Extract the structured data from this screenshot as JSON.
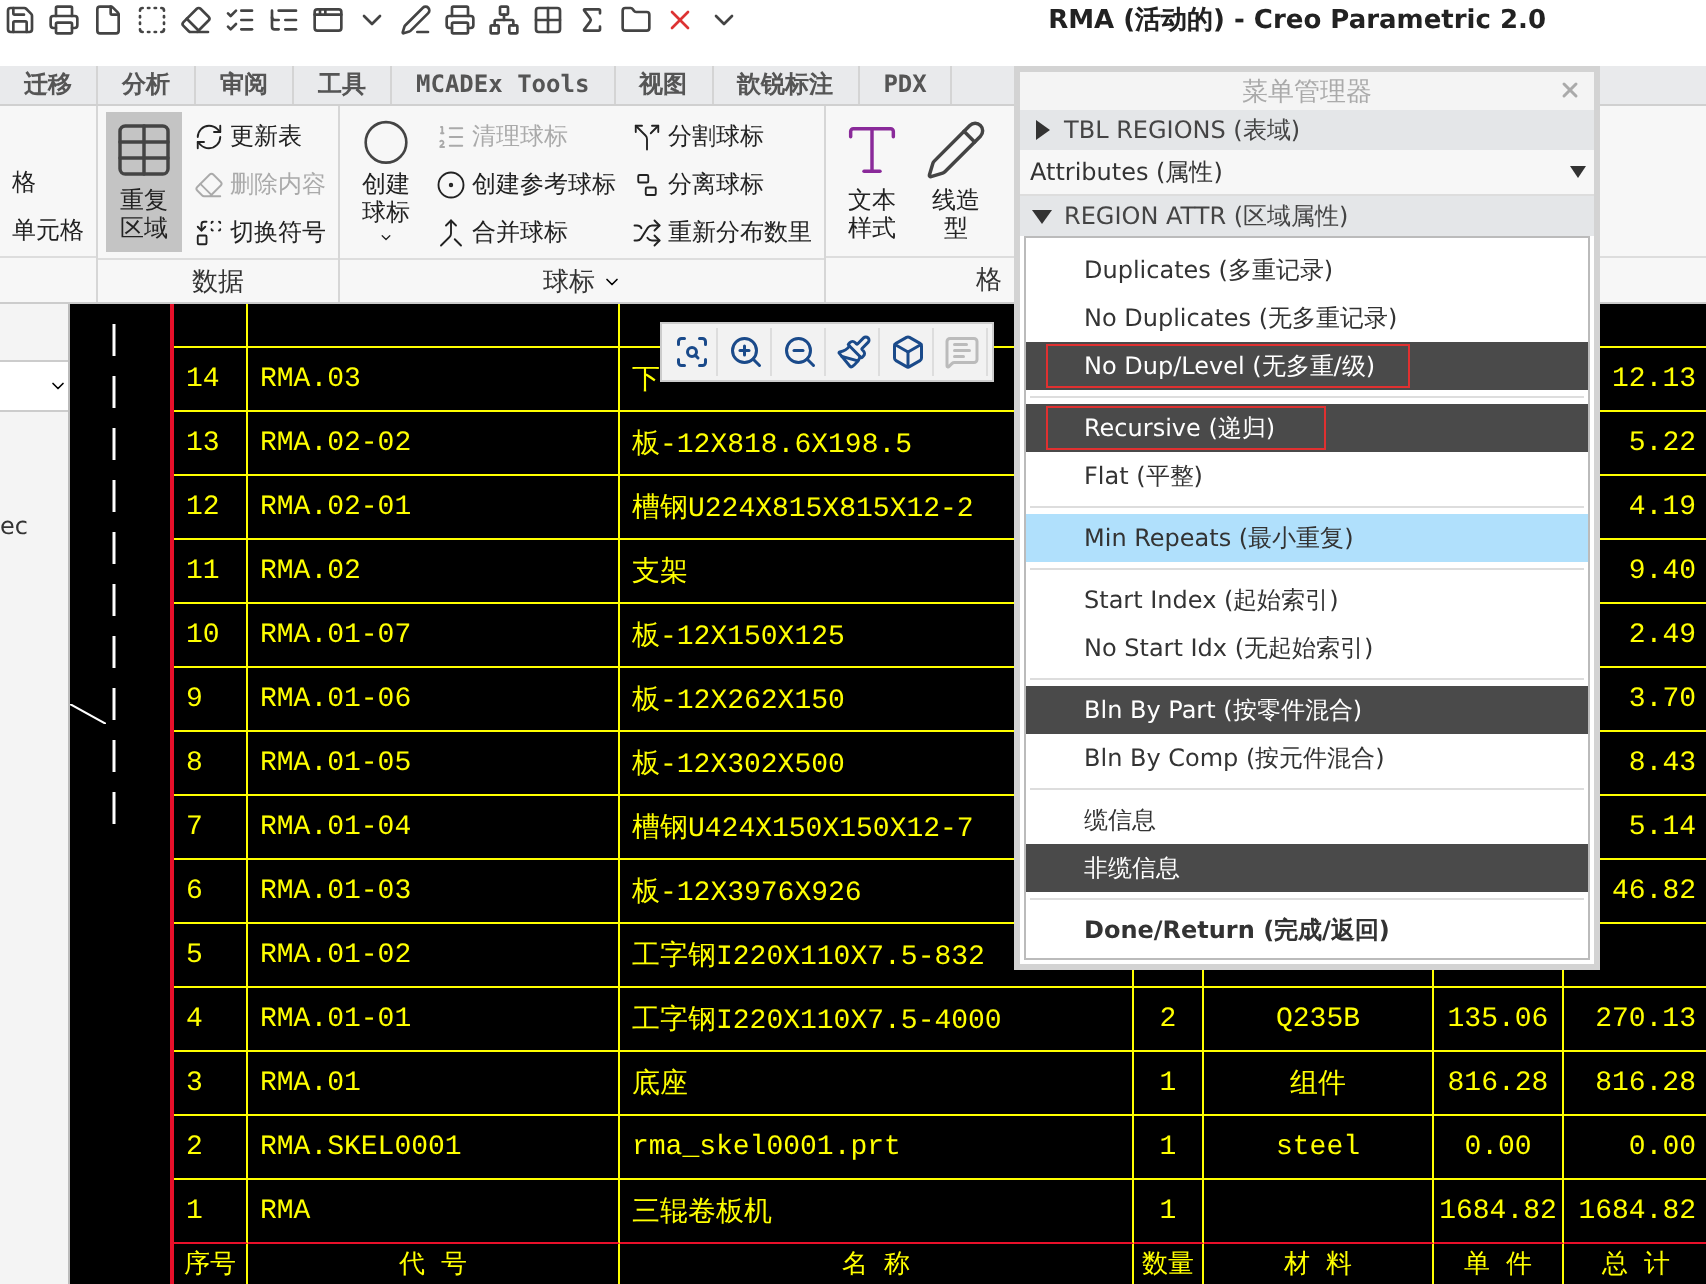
{
  "title_bar": {
    "title": "RMA (活动的) - Creo Parametric 2.0"
  },
  "ribbon_tabs": [
    {
      "label": "迁移",
      "selected": false
    },
    {
      "label": "分析",
      "selected": false
    },
    {
      "label": "审阅",
      "selected": false
    },
    {
      "label": "工具",
      "selected": false
    },
    {
      "label": "MCADEx Tools",
      "selected": false
    },
    {
      "label": "视图",
      "selected": false
    },
    {
      "label": "歆锐标注",
      "selected": false
    },
    {
      "label": "PDX",
      "selected": false
    }
  ],
  "ribbon": {
    "groups": [
      {
        "items": [
          {
            "label": "格",
            "kind": "small",
            "disabled": false,
            "selected": false
          },
          {
            "label": "单元格",
            "kind": "small",
            "disabled": false,
            "selected": false
          }
        ]
      },
      {
        "label": "数据",
        "items": [
          {
            "label": "重复区域",
            "kind": "large",
            "disabled": false,
            "selected": true
          },
          {
            "label": "更新表",
            "kind": "small",
            "disabled": false,
            "selected": false
          },
          {
            "label": "删除内容",
            "kind": "small",
            "disabled": true,
            "selected": false
          },
          {
            "label": "切换符号",
            "kind": "small",
            "disabled": false,
            "selected": false
          }
        ]
      },
      {
        "label": "球标",
        "dropdown": true,
        "items": [
          {
            "label": "创建球标",
            "kind": "large",
            "disabled": false,
            "selected": false,
            "dropdown": true
          },
          {
            "label": "清理球标",
            "kind": "small",
            "disabled": true,
            "selected": false
          },
          {
            "label": "创建参考球标",
            "kind": "small",
            "disabled": false,
            "selected": false
          },
          {
            "label": "合并球标",
            "kind": "small",
            "disabled": false,
            "selected": false
          },
          {
            "label": "分割球标",
            "kind": "small",
            "disabled": false,
            "selected": false
          },
          {
            "label": "分离球标",
            "kind": "small",
            "disabled": false,
            "selected": false
          },
          {
            "label": "重新分布数里",
            "kind": "small",
            "disabled": false,
            "selected": false
          }
        ]
      },
      {
        "label": "格",
        "items": [
          {
            "label": "文本样式",
            "kind": "large",
            "disabled": false,
            "selected": false
          },
          {
            "label": "线造型",
            "kind": "large",
            "disabled": false,
            "selected": false
          }
        ]
      }
    ]
  },
  "left_panel": {
    "text": "ec"
  },
  "table": {
    "rows": [
      {
        "cells": [
          "14",
          "RMA.03",
          "下",
          "",
          "",
          "",
          "12.13"
        ]
      },
      {
        "cells": [
          "13",
          "RMA.02-02",
          "板-12X818.6X198.5",
          "",
          "",
          "",
          "5.22"
        ]
      },
      {
        "cells": [
          "12",
          "RMA.02-01",
          "槽钢U224X815X815X12-2",
          "",
          "",
          "",
          "4.19"
        ]
      },
      {
        "cells": [
          "11",
          "RMA.02",
          "支架",
          "",
          "",
          "",
          "9.40"
        ]
      },
      {
        "cells": [
          "10",
          "RMA.01-07",
          "板-12X150X125",
          "",
          "",
          "",
          "2.49"
        ]
      },
      {
        "cells": [
          "9",
          "RMA.01-06",
          "板-12X262X150",
          "",
          "",
          "",
          "3.70"
        ]
      },
      {
        "cells": [
          "8",
          "RMA.01-05",
          "板-12X302X500",
          "",
          "",
          "",
          "8.43"
        ]
      },
      {
        "cells": [
          "7",
          "RMA.01-04",
          "槽钢U424X150X150X12-7",
          "",
          "",
          "",
          "5.14"
        ]
      },
      {
        "cells": [
          "6",
          "RMA.01-03",
          "板-12X3976X926",
          "",
          "",
          "",
          "46.82"
        ]
      },
      {
        "cells": [
          "5",
          "RMA.01-02",
          "工字钢I220X110X7.5-832",
          "",
          "",
          "",
          ""
        ]
      },
      {
        "cells": [
          "4",
          "RMA.01-01",
          "工字钢I220X110X7.5-4000",
          "2",
          "Q235B",
          "135.06",
          "270.13"
        ]
      },
      {
        "cells": [
          "3",
          "RMA.01",
          "底座",
          "1",
          "组件",
          "816.28",
          "816.28"
        ]
      },
      {
        "cells": [
          "2",
          "RMA.SKEL0001",
          "rma_skel0001.prt",
          "1",
          "steel",
          "0.00",
          "0.00"
        ]
      },
      {
        "cells": [
          "1",
          "RMA",
          "三辊卷板机",
          "1",
          "",
          "1684.82",
          "1684.82"
        ]
      }
    ],
    "header": [
      "序号",
      "代 号",
      "名 称",
      "数量",
      "材 料",
      "单 件",
      "总 计"
    ]
  },
  "mini_toolbar": {
    "buttons": [
      {
        "disabled": false
      },
      {
        "disabled": false
      },
      {
        "disabled": false
      },
      {
        "disabled": false
      },
      {
        "disabled": false
      },
      {
        "disabled": true
      }
    ]
  },
  "menu_manager": {
    "title": "菜单管理器",
    "sections": [
      {
        "label": "TBL REGIONS (表域)",
        "expanded": false
      },
      {
        "label": "REGION ATTR (区域属性)",
        "expanded": true
      }
    ],
    "attributes": {
      "value": "Attributes (属性)"
    },
    "groups": [
      [
        {
          "label": "Duplicates (多重记录)",
          "kind": "option",
          "selected": false,
          "highlighted": false,
          "boxed": false
        },
        {
          "label": "No Duplicates (无多重记录)",
          "kind": "option",
          "selected": false,
          "highlighted": false,
          "boxed": false
        },
        {
          "label": "No Dup/Level (无多重/级)",
          "kind": "option",
          "selected": true,
          "highlighted": false,
          "boxed": true
        }
      ],
      [
        {
          "label": "Recursive (递归)",
          "kind": "option",
          "selected": true,
          "highlighted": false,
          "boxed": true
        },
        {
          "label": "Flat (平整)",
          "kind": "option",
          "selected": false,
          "highlighted": false,
          "boxed": false
        }
      ],
      [
        {
          "label": "Min Repeats (最小重复)",
          "kind": "option",
          "selected": false,
          "highlighted": true,
          "boxed": false
        }
      ],
      [
        {
          "label": "Start Index (起始索引)",
          "kind": "option",
          "selected": false,
          "highlighted": false,
          "boxed": false
        },
        {
          "label": "No Start Idx (无起始索引)",
          "kind": "option",
          "selected": false,
          "highlighted": false,
          "boxed": false
        }
      ],
      [
        {
          "label": "Bln By Part (按零件混合)",
          "kind": "option",
          "selected": true,
          "highlighted": false,
          "boxed": false
        },
        {
          "label": "Bln By Comp (按元件混合)",
          "kind": "option",
          "selected": false,
          "highlighted": false,
          "boxed": false
        }
      ],
      [
        {
          "label": "缆信息",
          "kind": "option",
          "selected": false,
          "highlighted": false,
          "boxed": false
        },
        {
          "label": "非缆信息",
          "kind": "option",
          "selected": true,
          "highlighted": false,
          "boxed": false
        }
      ],
      [
        {
          "label": "Done/Return (完成/返回)",
          "kind": "action",
          "selected": false,
          "highlighted": false,
          "boxed": false
        }
      ]
    ]
  }
}
